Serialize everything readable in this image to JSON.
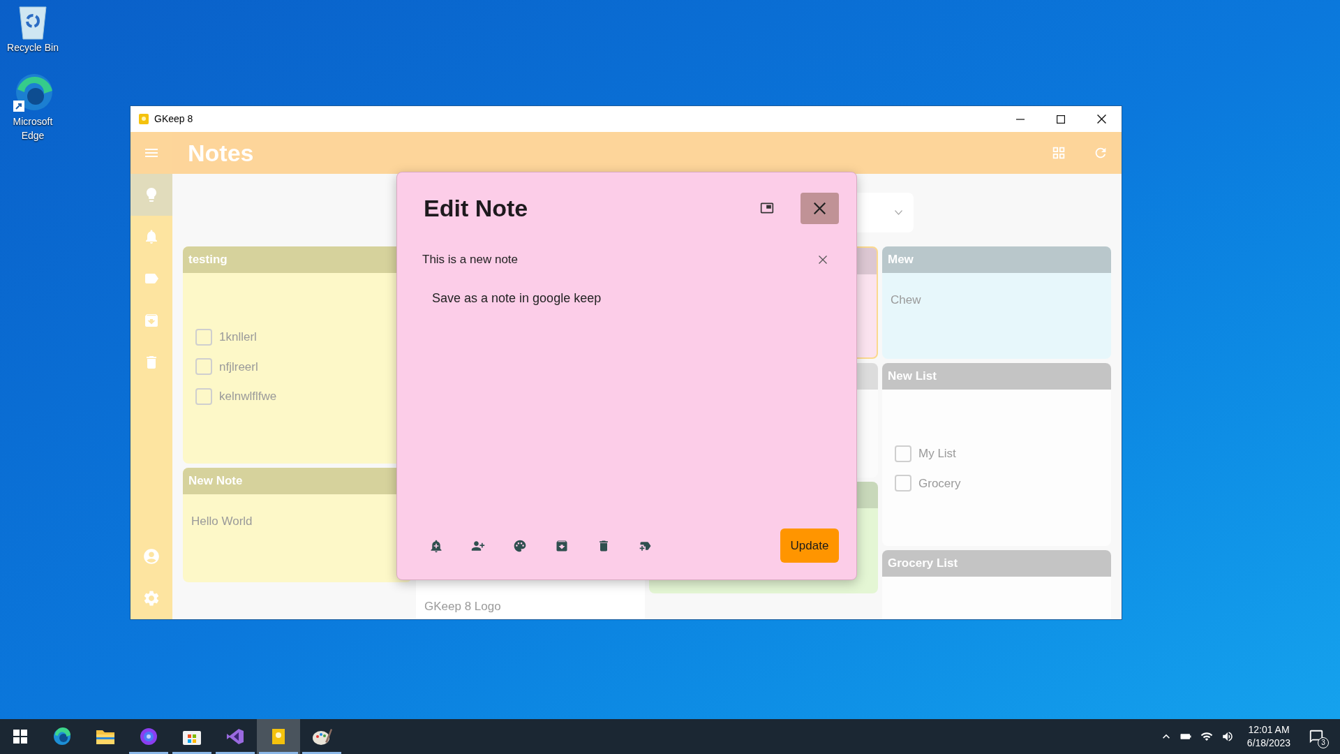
{
  "desktop_icons": [
    {
      "label": "Recycle Bin",
      "kind": "recycle"
    },
    {
      "label": "Microsoft Edge",
      "kind": "edge"
    }
  ],
  "window": {
    "title": "GKeep 8"
  },
  "header": {
    "title": "Notes"
  },
  "sidebar": {
    "items": [
      {
        "kind": "bulb",
        "selected": true
      },
      {
        "kind": "bell",
        "selected": false
      },
      {
        "kind": "label",
        "selected": false
      },
      {
        "kind": "archive",
        "selected": false
      },
      {
        "kind": "trash",
        "selected": false
      }
    ],
    "bottom_items": [
      {
        "kind": "account"
      },
      {
        "kind": "settings"
      }
    ]
  },
  "columns": [
    [
      {
        "kind": "list",
        "title": "testing",
        "color": "#fdf8c8",
        "selected": false,
        "items": [
          {
            "label": "1knllerl",
            "checked": false
          },
          {
            "label": "nfjlreerl",
            "checked": false
          },
          {
            "label": "kelnwlflfwe",
            "checked": false
          }
        ]
      },
      {
        "kind": "text",
        "title": "New Note",
        "color": "#fdf8c8",
        "selected": false,
        "body": "Hello World"
      }
    ],
    [
      {
        "kind": "text",
        "color": "#ffffff",
        "selected": false,
        "body": "GKeep 8 Logo"
      }
    ],
    [
      {
        "kind": "blank",
        "color": "#fbe3ef",
        "selected": true
      },
      {
        "kind": "blank",
        "color": "#fbfbfb",
        "selected": false
      },
      {
        "kind": "blank",
        "color": "#e4f6d4",
        "selected": false
      }
    ],
    [
      {
        "kind": "text",
        "title": "Mew",
        "color": "#e7f7fb",
        "selected": false,
        "body": "Chew"
      },
      {
        "kind": "list",
        "title": "New List",
        "color": "#fdfdfd",
        "selected": false,
        "items": [
          {
            "label": "My List",
            "checked": false
          },
          {
            "label": "Grocery",
            "checked": false
          }
        ]
      },
      {
        "kind": "blank",
        "title": "Grocery List",
        "color": "#fdfdfd",
        "selected": false
      }
    ]
  ],
  "dialog": {
    "title": "Edit Note",
    "note_title": "This is a new note",
    "body": "Save as a note in google keep",
    "actions": [
      {
        "kind": "reminder"
      },
      {
        "kind": "collaborator"
      },
      {
        "kind": "color"
      },
      {
        "kind": "archive"
      },
      {
        "kind": "delete"
      },
      {
        "kind": "label"
      }
    ],
    "update_button": "Update"
  },
  "taskbar": {
    "apps": [
      {
        "kind": "edge",
        "running": false,
        "selected": false
      },
      {
        "kind": "explorer",
        "running": false,
        "selected": false
      },
      {
        "kind": "firefox",
        "running": true,
        "selected": false
      },
      {
        "kind": "store",
        "running": true,
        "selected": false
      },
      {
        "kind": "vs",
        "running": true,
        "selected": false
      },
      {
        "kind": "gkeep",
        "running": true,
        "selected": true
      },
      {
        "kind": "paint",
        "running": true,
        "selected": false
      }
    ],
    "time": "12:01 AM",
    "date": "6/18/2023",
    "notifications": "3"
  }
}
